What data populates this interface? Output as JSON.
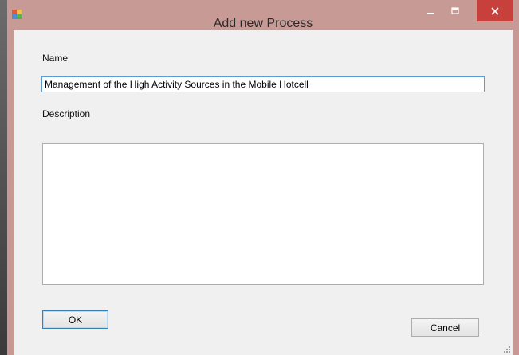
{
  "window": {
    "title": "Add new Process",
    "controls": {
      "minimize_icon": "minimize-icon",
      "maximize_icon": "maximize-icon",
      "close_icon": "close-icon"
    }
  },
  "form": {
    "name_label": "Name",
    "name_value": "Management of the High Activity Sources in the Mobile Hotcell",
    "description_label": "Description",
    "description_value": ""
  },
  "buttons": {
    "ok_label": "OK",
    "cancel_label": "Cancel"
  },
  "colors": {
    "titlebar": "#c79a96",
    "close_button": "#c7403b",
    "input_focus_border": "#5a9bd6",
    "dialog_background": "#f0f0f0"
  }
}
